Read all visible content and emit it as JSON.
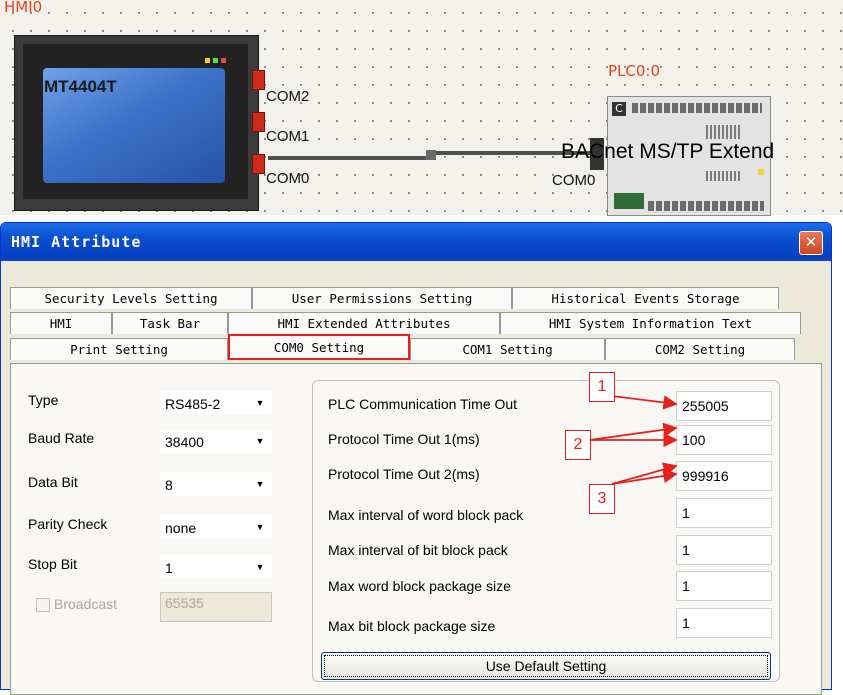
{
  "canvas": {
    "hmi_label": "HMI0",
    "hmi_model": "MT4404T",
    "ports": [
      "COM2",
      "COM1",
      "COM0"
    ],
    "plc_label": "PLC0:0",
    "plc_model": "BACnet MS/TP Extend",
    "plc_port": "COM0"
  },
  "dialog": {
    "title": "HMI Attribute",
    "close_icon": "close-icon"
  },
  "tabs": {
    "row1": [
      "Security Levels Setting",
      "User Permissions Setting",
      "Historical Events Storage"
    ],
    "row2": [
      "HMI",
      "Task Bar",
      "HMI Extended Attributes",
      "HMI System Information Text"
    ],
    "row3": [
      "Print Setting",
      "COM0 Setting",
      "COM1 Setting",
      "COM2 Setting"
    ],
    "active": "COM0 Setting"
  },
  "com_settings": {
    "type_label": "Type",
    "type_value": "RS485-2",
    "baud_label": "Baud Rate",
    "baud_value": "38400",
    "databit_label": "Data Bit",
    "databit_value": "8",
    "parity_label": "Parity Check",
    "parity_value": "none",
    "stopbit_label": "Stop Bit",
    "stopbit_value": "1",
    "broadcast_label": "Broadcast",
    "broadcast_value": "65535"
  },
  "plc_timeouts": {
    "items": [
      {
        "label": "PLC Communication Time Out",
        "value": "255005"
      },
      {
        "label": "Protocol Time Out 1(ms)",
        "value": "100"
      },
      {
        "label": "Protocol Time Out 2(ms)",
        "value": "999916"
      },
      {
        "label": "Max interval of word block pack",
        "value": "1"
      },
      {
        "label": "Max interval of bit block pack",
        "value": "1"
      },
      {
        "label": "Max word block package size",
        "value": "1"
      },
      {
        "label": "Max bit block package size",
        "value": "1"
      }
    ],
    "default_button": "Use Default Setting"
  },
  "annotations": [
    "1",
    "2",
    "3"
  ],
  "colors": {
    "highlight": "#e8201c",
    "titlebar": "#0a4fd0",
    "port": "#cc2a1a"
  }
}
